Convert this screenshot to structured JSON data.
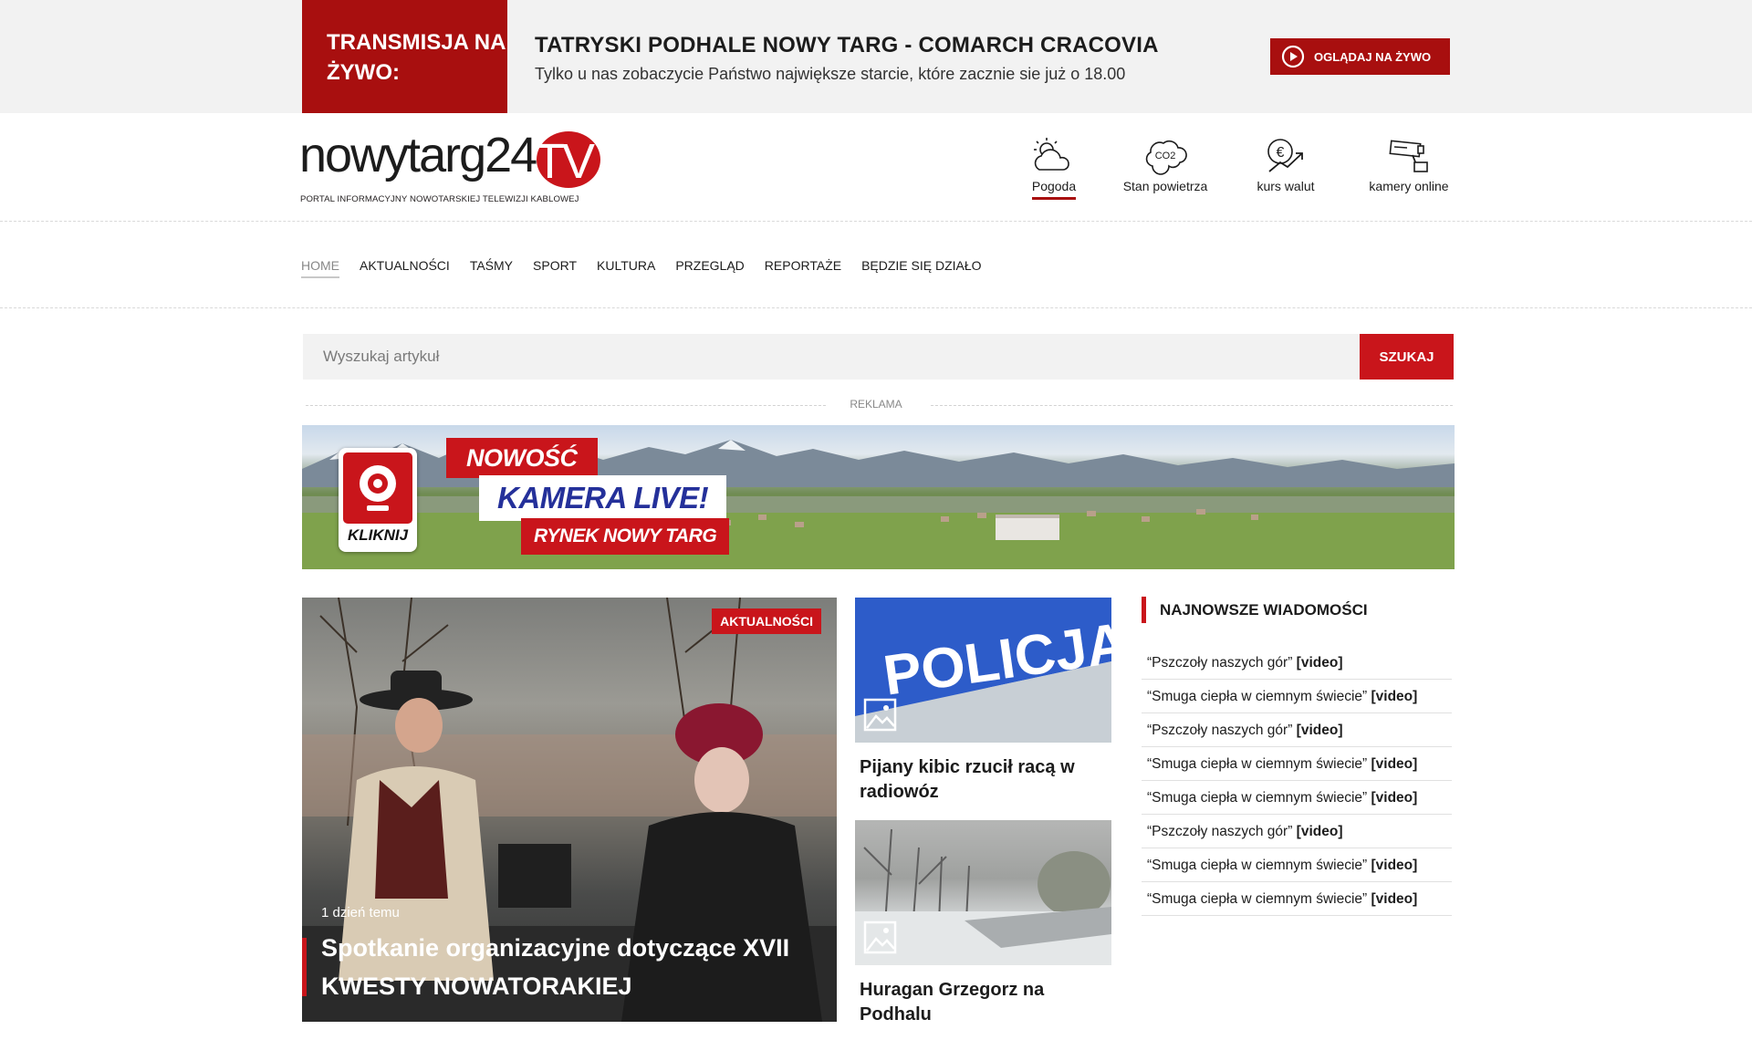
{
  "live": {
    "label": "TRANSMISJA NA ŻYWO:",
    "title": "TATRYSKI PODHALE NOWY TARG - COMARCH CRACOVIA",
    "description": "Tylko u nas zobaczycie Państwo największe starcie, które zacznie sie już o 18.00",
    "button": "OGLĄDAJ NA ŻYWO"
  },
  "logo": {
    "main": "nowytarg24",
    "tv": ".TV",
    "subtitle": "PORTAL INFORMACYJNY NOWOTARSKIEJ TELEWIZJI KABLOWEJ"
  },
  "tools": [
    {
      "label": "Pogoda",
      "icon": "weather-icon",
      "active": true
    },
    {
      "label": "Stan powietrza",
      "icon": "co2-cloud-icon",
      "active": false
    },
    {
      "label": "kurs walut",
      "icon": "euro-chart-icon",
      "active": false
    },
    {
      "label": "kamery online",
      "icon": "cctv-camera-icon",
      "active": false
    }
  ],
  "nav": [
    "HOME",
    "AKTUALNOŚCI",
    "TAŚMY",
    "SPORT",
    "KULTURA",
    "PRZEGLĄD",
    "REPORTAŻE",
    "BĘDZIE SIĘ DZIAŁO"
  ],
  "search": {
    "placeholder": "Wyszukaj artykuł",
    "button": "SZUKAJ"
  },
  "ad": {
    "label": "REKLAMA",
    "new": "NOWOŚĆ",
    "camera": "KAMERA LIVE!",
    "place": "RYNEK NOWY TARG",
    "click": "KLIKNIJ"
  },
  "main_article": {
    "category": "AKTUALNOŚCI",
    "time": "1 dzień temu",
    "title": "Spotkanie organizacyjne dotyczące XVII KWESTY NOWATORAKIEJ"
  },
  "side_articles": [
    {
      "title": "Pijany kibic rzucił racą w radiowóz",
      "image_text": "POLICJA"
    },
    {
      "title": "Huragan Grzegorz na Podhalu"
    }
  ],
  "latest": {
    "heading": "NAJNOWSZE WIADOMOŚCI",
    "items": [
      {
        "text": "“Pszczoły naszych gór”",
        "tag": "[video]"
      },
      {
        "text": "“Smuga ciepła w ciemnym świecie”",
        "tag": "[video]"
      },
      {
        "text": "“Pszczoły naszych gór”",
        "tag": "[video]"
      },
      {
        "text": "“Smuga ciepła w ciemnym świecie”",
        "tag": "[video]"
      },
      {
        "text": "“Smuga ciepła w ciemnym świecie”",
        "tag": "[video]"
      },
      {
        "text": "“Pszczoły naszych gór”",
        "tag": "[video]"
      },
      {
        "text": "“Smuga ciepła w ciemnym świecie”",
        "tag": "[video]"
      },
      {
        "text": "“Smuga ciepła w ciemnym świecie”",
        "tag": "[video]"
      }
    ]
  },
  "colors": {
    "accent": "#c9151b",
    "dark_red": "#a80f0f",
    "bar_bg": "#f2f2f2"
  }
}
